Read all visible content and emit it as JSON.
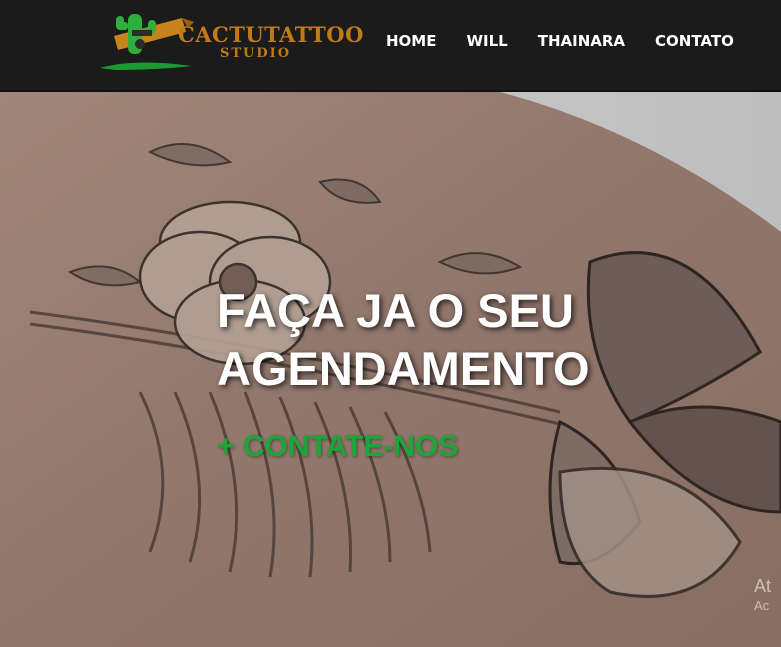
{
  "header": {
    "logo": {
      "title": "CACTUTATTOO",
      "subtitle": "STUDIO"
    },
    "nav": [
      {
        "label": "HOME"
      },
      {
        "label": "WILL"
      },
      {
        "label": "THAINARA"
      },
      {
        "label": "CONTATO"
      }
    ]
  },
  "hero": {
    "headline_line1": "FAÇA JA O SEU",
    "headline_line2": "AGENDAMENTO",
    "cta_label": "+ CONTATE-NOS",
    "watermark_line1": "At",
    "watermark_line2": "Ac"
  },
  "colors": {
    "header_bg": "#1b1b1b",
    "logo_orange": "#c07a1a",
    "cta_green": "#1ea53a"
  },
  "icons": [
    "cactus-tattoo-machine-icon"
  ]
}
